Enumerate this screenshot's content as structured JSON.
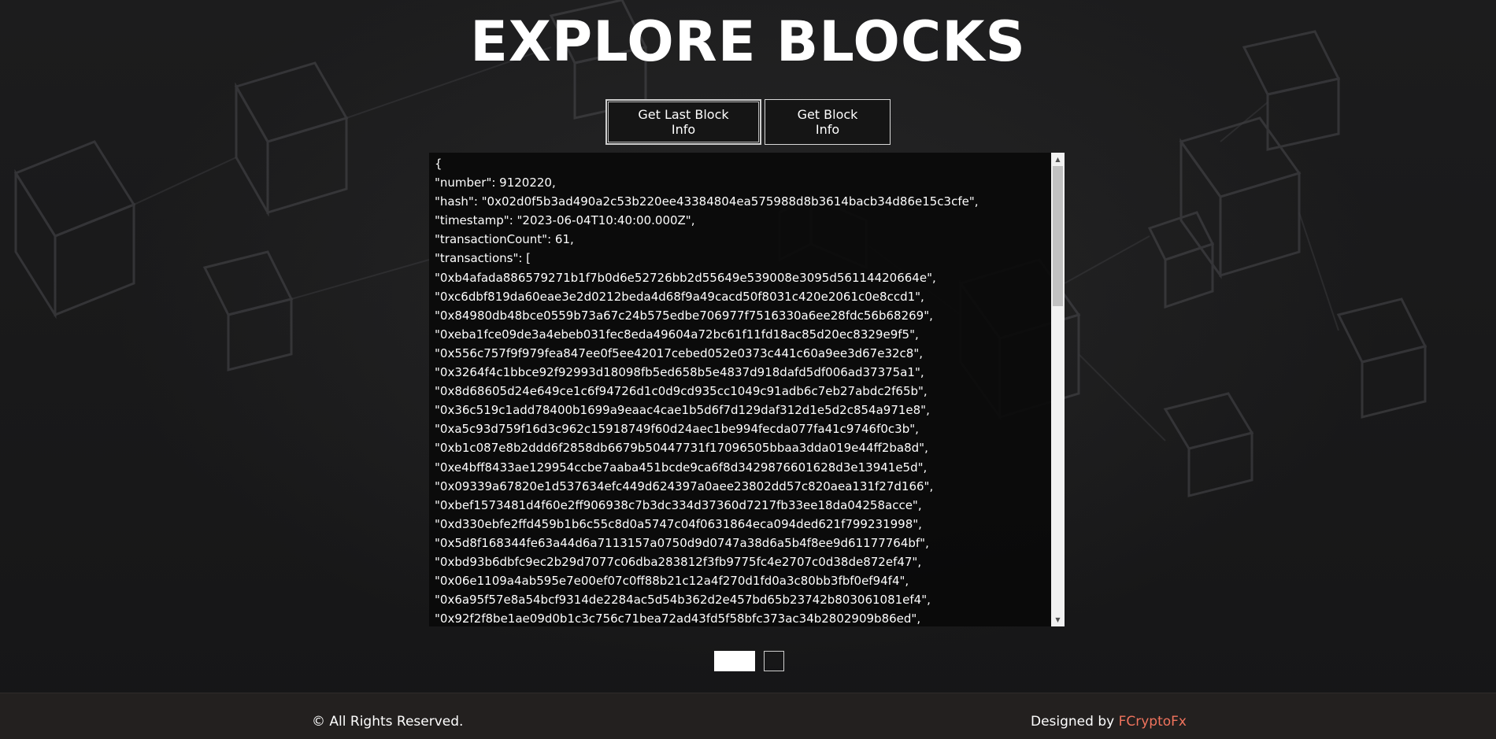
{
  "page": {
    "title": "EXPLORE BLOCKS"
  },
  "buttons": {
    "last_block_label": "Get Last Block Info",
    "block_label": "Get Block Info"
  },
  "json_output": {
    "lines": [
      "{",
      "\"number\": 9120220,",
      "\"hash\": \"0x02d0f5b3ad490a2c53b220ee43384804ea575988d8b3614bacb34d86e15c3cfe\",",
      "\"timestamp\": \"2023-06-04T10:40:00.000Z\",",
      "\"transactionCount\": 61,",
      "\"transactions\": [",
      "\"0xb4afada886579271b1f7b0d6e52726bb2d55649e539008e3095d56114420664e\",",
      "\"0xc6dbf819da60eae3e2d0212beda4d68f9a49cacd50f8031c420e2061c0e8ccd1\",",
      "\"0x84980db48bce0559b73a67c24b575edbe706977f7516330a6ee28fdc56b68269\",",
      "\"0xeba1fce09de3a4ebeb031fec8eda49604a72bc61f11fd18ac85d20ec8329e9f5\",",
      "\"0x556c757f9f979fea847ee0f5ee42017cebed052e0373c441c60a9ee3d67e32c8\",",
      "\"0x3264f4c1bbce92f92993d18098fb5ed658b5e4837d918dafd5df006ad37375a1\",",
      "\"0x8d68605d24e649ce1c6f94726d1c0d9cd935cc1049c91adb6c7eb27abdc2f65b\",",
      "\"0x36c519c1add78400b1699a9eaac4cae1b5d6f7d129daf312d1e5d2c854a971e8\",",
      "\"0xa5c93d759f16d3c962c15918749f60d24aec1be994fecda077fa41c9746f0c3b\",",
      "\"0xb1c087e8b2ddd6f2858db6679b50447731f17096505bbaa3dda019e44ff2ba8d\",",
      "\"0xe4bff8433ae129954ccbe7aaba451bcde9ca6f8d3429876601628d3e13941e5d\",",
      "\"0x09339a67820e1d537634efc449d624397a0aee23802dd57c820aea131f27d166\",",
      "\"0xbef1573481d4f60e2ff906938c7b3dc334d37360d7217fb33ee18da04258acce\",",
      "\"0xd330ebfe2ffd459b1b6c55c8d0a5747c04f0631864eca094ded621f799231998\",",
      "\"0x5d8f168344fe63a44d6a7113157a0750d9d0747a38d6a5b4f8ee9d61177764bf\",",
      "\"0xbd93b6dbfc9ec2b29d7077c06dba283812f3fb9775fc4e2707c0d38de872ef47\",",
      "\"0x06e1109a4ab595e7e00ef07c0ff88b21c12a4f270d1fd0a3c80bb3fbf0ef94f4\",",
      "\"0x6a95f57e8a54bcf9314de2284ac5d54b362d2e457bd65b23742b803061081ef4\",",
      "\"0x92f2f8be1ae09d0b1c3c756c71bea72ad43fd5f58bfc373ac34b2802909b86ed\","
    ]
  },
  "pagination": {
    "pages": 2,
    "active_page": 1
  },
  "footer": {
    "copyright": "© All Rights Reserved.",
    "designed_by_prefix": "Designed by ",
    "designer_name": "FCryptoFx"
  },
  "colors": {
    "background": "#1b1a1a",
    "footer_bg": "#23201f",
    "accent_link": "#f0735d",
    "text": "#ffffff"
  },
  "icons": {
    "scroll_up": "triangle-up-icon",
    "scroll_down": "triangle-down-icon"
  }
}
